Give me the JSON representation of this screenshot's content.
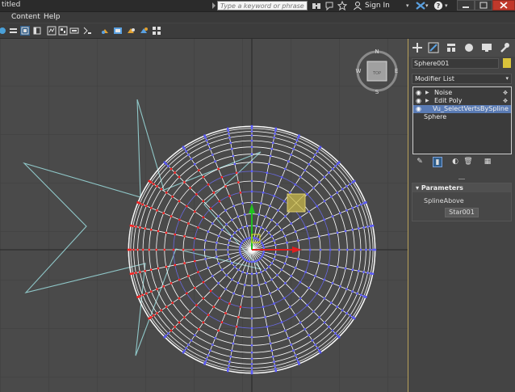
{
  "title_bar": {
    "title": "titled",
    "search_placeholder": "Type a keyword or phrase",
    "sign_in": "Sign In",
    "help_icon": "?"
  },
  "menu": {
    "items": [
      "Content",
      "Help"
    ]
  },
  "viewport": {
    "viewcube_label": "TOP",
    "compass": {
      "n": "N",
      "s": "S",
      "e": "E",
      "w": "W"
    },
    "icons": [
      "star-spline",
      "sphere-wireframe",
      "move-gizmo",
      "modifier-gizmo"
    ],
    "colors": {
      "star": "#8fc7c8",
      "wire": "#ffffff",
      "verts": "#5b5bff",
      "selected_verts": "#ff2020",
      "gizmo_box": "#bfb35a"
    }
  },
  "command_panel": {
    "object_name": "Sphere001",
    "object_color": "#d8c23a",
    "modifier_list_label": "Modifier List",
    "stack": [
      {
        "label": "Noise",
        "selected": false
      },
      {
        "label": "Edit Poly",
        "selected": false
      },
      {
        "label": "Vu_SelectVertsBySpline",
        "selected": true
      },
      {
        "label": "Sphere",
        "selected": false
      }
    ],
    "parameters_title": "Parameters",
    "spline_above_label": "SplineAbove",
    "spline_button": "Star001"
  }
}
